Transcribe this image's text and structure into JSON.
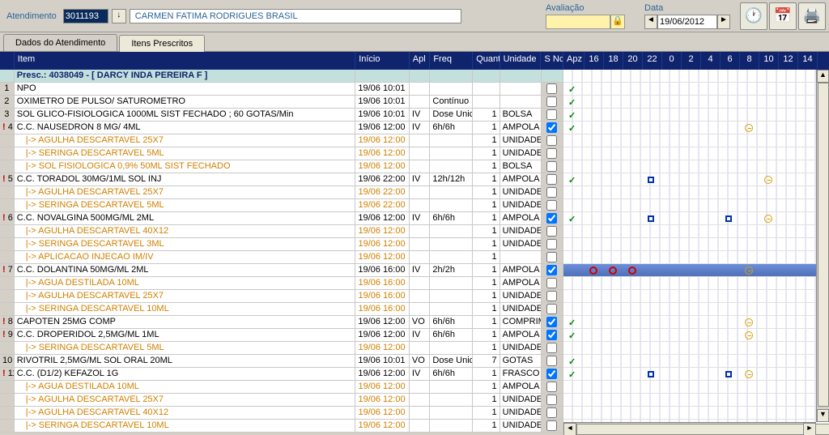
{
  "topbar": {
    "atend_label": "Atendimento",
    "atend_value": "3011193",
    "patient_name": "CARMEN FATIMA RODRIGUES BRASIL",
    "avaliacao_label": "Avaliação",
    "data_label": "Data",
    "date_value": "19/06/2012"
  },
  "tabs": {
    "t1": "Dados do Atendimento",
    "t2": "Itens Prescritos"
  },
  "headers": {
    "item": "Item",
    "inicio": "Início",
    "apl": "Apl",
    "freq": "Freq",
    "quant": "Quant",
    "unidade": "Unidade",
    "sncs": "S Ncs",
    "apz": "Apz"
  },
  "time_cols": [
    "16",
    "18",
    "20",
    "22",
    "0",
    "2",
    "4",
    "6",
    "8",
    "10",
    "12",
    "14"
  ],
  "presc_header": "Presc.: 4038049 - [ DARCY INDA PEREIRA F ]",
  "rows": [
    {
      "n": "1",
      "flag": false,
      "item": "NPO",
      "inicio": "19/06 10:01",
      "apl": "",
      "freq": "",
      "q": "",
      "u": "",
      "s": false,
      "sub": false,
      "marks": {
        "apz": "tick"
      }
    },
    {
      "n": "2",
      "flag": false,
      "item": "OXIMETRO DE PULSO/ SATUROMETRO",
      "inicio": "19/06 10:01",
      "apl": "",
      "freq": "Contínuo",
      "q": "",
      "u": "",
      "s": false,
      "sub": false,
      "marks": {
        "apz": "tick"
      }
    },
    {
      "n": "3",
      "flag": false,
      "item": "SOL GLICO-FISIOLOGICA 1000ML SIST FECHADO ; 60 GOTAS/Min",
      "inicio": "19/06 10:01",
      "apl": "IV",
      "freq": "Dose Unic",
      "q": "1",
      "u": "BOLSA",
      "s": false,
      "sub": false,
      "marks": {
        "apz": "tick"
      }
    },
    {
      "n": "4",
      "flag": true,
      "item": "C.C. NAUSEDRON 8 MG/ 4ML",
      "inicio": "19/06 12:00",
      "apl": "IV",
      "freq": "6h/6h",
      "q": "1",
      "u": "AMPOLA",
      "s": true,
      "sub": false,
      "marks": {
        "apz": "tick",
        "8": "clk"
      }
    },
    {
      "n": "",
      "flag": false,
      "item": "|-> AGULHA DESCARTAVEL 25X7",
      "inicio": "19/06 12:00",
      "apl": "",
      "freq": "",
      "q": "1",
      "u": "UNIDADE",
      "s": false,
      "sub": true,
      "marks": {}
    },
    {
      "n": "",
      "flag": false,
      "item": "|-> SERINGA DESCARTAVEL 5ML",
      "inicio": "19/06 12:00",
      "apl": "",
      "freq": "",
      "q": "1",
      "u": "UNIDADE",
      "s": false,
      "sub": true,
      "marks": {}
    },
    {
      "n": "",
      "flag": false,
      "item": "|-> SOL FISIOLOGICA 0,9% 50ML SIST FECHADO",
      "inicio": "19/06 12:00",
      "apl": "",
      "freq": "",
      "q": "1",
      "u": "BOLSA",
      "s": false,
      "sub": true,
      "marks": {}
    },
    {
      "n": "5",
      "flag": true,
      "item": "C.C. TORADOL 30MG/1ML SOL INJ",
      "inicio": "19/06 22:00",
      "apl": "IV",
      "freq": "12h/12h",
      "q": "1",
      "u": "AMPOLA",
      "s": false,
      "sub": false,
      "marks": {
        "apz": "tick",
        "22": "sq",
        "10": "clk"
      }
    },
    {
      "n": "",
      "flag": false,
      "item": "|-> AGULHA DESCARTAVEL 25X7",
      "inicio": "19/06 22:00",
      "apl": "",
      "freq": "",
      "q": "1",
      "u": "UNIDADE",
      "s": false,
      "sub": true,
      "marks": {}
    },
    {
      "n": "",
      "flag": false,
      "item": "|-> SERINGA DESCARTAVEL 5ML",
      "inicio": "19/06 22:00",
      "apl": "",
      "freq": "",
      "q": "1",
      "u": "UNIDADE",
      "s": false,
      "sub": true,
      "marks": {}
    },
    {
      "n": "6",
      "flag": true,
      "item": "C.C. NOVALGINA 500MG/ML 2ML",
      "inicio": "19/06 12:00",
      "apl": "IV",
      "freq": "6h/6h",
      "q": "1",
      "u": "AMPOLA",
      "s": true,
      "sub": false,
      "marks": {
        "apz": "tick",
        "22": "sq",
        "6": "sq",
        "10": "clk"
      }
    },
    {
      "n": "",
      "flag": false,
      "item": "|-> AGULHA DESCARTAVEL 40X12",
      "inicio": "19/06 12:00",
      "apl": "",
      "freq": "",
      "q": "1",
      "u": "UNIDADE",
      "s": false,
      "sub": true,
      "marks": {}
    },
    {
      "n": "",
      "flag": false,
      "item": "|-> SERINGA DESCARTAVEL 3ML",
      "inicio": "19/06 12:00",
      "apl": "",
      "freq": "",
      "q": "1",
      "u": "UNIDADE",
      "s": false,
      "sub": true,
      "marks": {}
    },
    {
      "n": "",
      "flag": false,
      "item": "|-> APLICACAO INJECAO IM/IV",
      "inicio": "19/06 12:00",
      "apl": "",
      "freq": "",
      "q": "1",
      "u": "",
      "s": false,
      "sub": true,
      "marks": {}
    },
    {
      "n": "7",
      "flag": true,
      "item": "C.C. DOLANTINA 50MG/ML 2ML",
      "inicio": "19/06 16:00",
      "apl": "IV",
      "freq": "2h/2h",
      "q": "1",
      "u": "AMPOLA",
      "s": true,
      "sub": false,
      "marks": {
        "highlight": true,
        "16": "dot",
        "18": "dot",
        "20": "dot",
        "8": "clk"
      }
    },
    {
      "n": "",
      "flag": false,
      "item": "|-> AGUA DESTILADA 10ML",
      "inicio": "19/06 16:00",
      "apl": "",
      "freq": "",
      "q": "1",
      "u": "AMPOLA",
      "s": false,
      "sub": true,
      "marks": {}
    },
    {
      "n": "",
      "flag": false,
      "item": "|-> AGULHA DESCARTAVEL 25X7",
      "inicio": "19/06 16:00",
      "apl": "",
      "freq": "",
      "q": "1",
      "u": "UNIDADE",
      "s": false,
      "sub": true,
      "marks": {}
    },
    {
      "n": "",
      "flag": false,
      "item": "|-> SERINGA DESCARTAVEL 10ML",
      "inicio": "19/06 16:00",
      "apl": "",
      "freq": "",
      "q": "1",
      "u": "UNIDADE",
      "s": false,
      "sub": true,
      "marks": {}
    },
    {
      "n": "8",
      "flag": true,
      "item": "CAPOTEN 25MG COMP",
      "inicio": "19/06 12:00",
      "apl": "VO",
      "freq": "6h/6h",
      "q": "1",
      "u": "COMPRIMIDO",
      "s": true,
      "sub": false,
      "marks": {
        "apz": "tick",
        "8": "clk"
      }
    },
    {
      "n": "9",
      "flag": true,
      "item": "C.C. DROPERIDOL 2,5MG/ML 1ML",
      "inicio": "19/06 12:00",
      "apl": "IV",
      "freq": "6h/6h",
      "q": "1",
      "u": "AMPOLA",
      "s": true,
      "sub": false,
      "marks": {
        "apz": "tick",
        "8": "clk"
      }
    },
    {
      "n": "",
      "flag": false,
      "item": "|-> SERINGA DESCARTAVEL 5ML",
      "inicio": "19/06 12:00",
      "apl": "",
      "freq": "",
      "q": "1",
      "u": "UNIDADE",
      "s": false,
      "sub": true,
      "marks": {}
    },
    {
      "n": "10",
      "flag": false,
      "item": "RIVOTRIL 2,5MG/ML SOL ORAL 20ML",
      "inicio": "19/06 10:01",
      "apl": "VO",
      "freq": "Dose Unic",
      "q": "7",
      "u": "GOTAS",
      "s": false,
      "sub": false,
      "marks": {
        "apz": "tick"
      }
    },
    {
      "n": "11",
      "flag": true,
      "item": "C.C. (D1/2) KEFAZOL 1G",
      "inicio": "19/06 12:00",
      "apl": "IV",
      "freq": "6h/6h",
      "q": "1",
      "u": "FRASCO AM",
      "s": true,
      "sub": false,
      "marks": {
        "apz": "tick",
        "22": "sq",
        "6": "sq",
        "8": "clk"
      }
    },
    {
      "n": "",
      "flag": false,
      "item": "|-> AGUA DESTILADA 10ML",
      "inicio": "19/06 12:00",
      "apl": "",
      "freq": "",
      "q": "1",
      "u": "AMPOLA",
      "s": false,
      "sub": true,
      "marks": {}
    },
    {
      "n": "",
      "flag": false,
      "item": "|-> AGULHA DESCARTAVEL 25X7",
      "inicio": "19/06 12:00",
      "apl": "",
      "freq": "",
      "q": "1",
      "u": "UNIDADE",
      "s": false,
      "sub": true,
      "marks": {}
    },
    {
      "n": "",
      "flag": false,
      "item": "|-> AGULHA DESCARTAVEL 40X12",
      "inicio": "19/06 12:00",
      "apl": "",
      "freq": "",
      "q": "1",
      "u": "UNIDADE",
      "s": false,
      "sub": true,
      "marks": {}
    },
    {
      "n": "",
      "flag": false,
      "item": "|-> SERINGA DESCARTAVEL 10ML",
      "inicio": "19/06 12:00",
      "apl": "",
      "freq": "",
      "q": "1",
      "u": "UNIDADE",
      "s": false,
      "sub": true,
      "marks": {}
    }
  ]
}
